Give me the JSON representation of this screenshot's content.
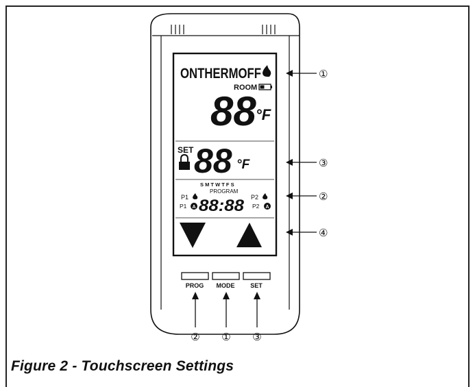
{
  "display": {
    "mode_text": "ONTHERMOFF",
    "room_label": "ROOM",
    "room_temp": "88",
    "temp_unit": "°F",
    "set_label": "SET",
    "set_temp": "88",
    "days": "S M T W T F S",
    "program_label": "PROGRAM",
    "p1_flame": "P1",
    "p2_flame": "P2",
    "p1_pilot": "P1",
    "p2_pilot": "P2",
    "clock": "88:88"
  },
  "buttons": {
    "prog": "PROG",
    "mode": "MODE",
    "set": "SET"
  },
  "callouts": {
    "mode_row": "①",
    "set_row": "③",
    "program_row": "②",
    "arrow_row": "④",
    "prog_button": "②",
    "mode_button": "①",
    "set_button": "③"
  },
  "caption": "Figure 2 - Touchscreen Settings",
  "icons": [
    "flame-icon",
    "battery-icon",
    "lock-icon",
    "pilot-icon",
    "down-arrow-icon",
    "up-arrow-icon"
  ]
}
